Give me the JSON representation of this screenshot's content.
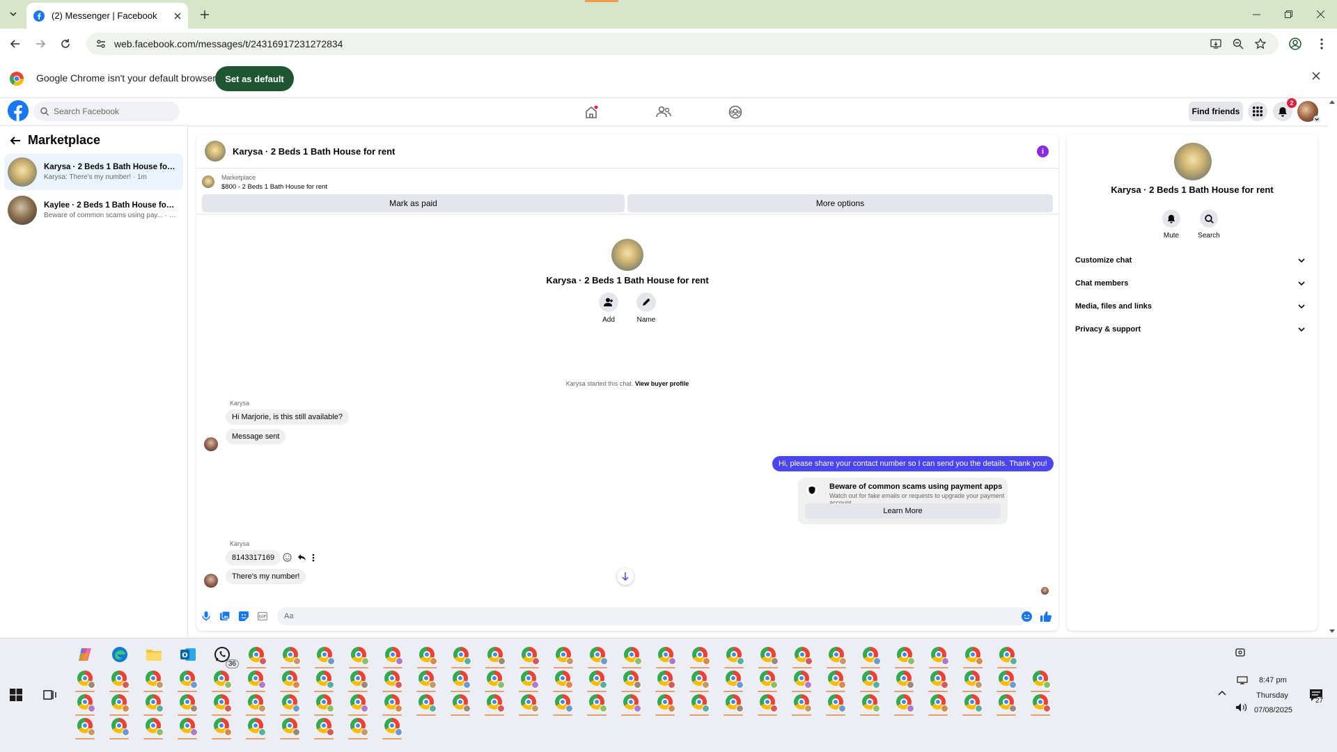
{
  "browser": {
    "tab_title": "(2) Messenger | Facebook",
    "url": "web.facebook.com/messages/t/24316917231272834",
    "infobar_text": "Google Chrome isn't your default browser",
    "infobar_button": "Set as default"
  },
  "fb_header": {
    "search_placeholder": "Search Facebook",
    "find_friends": "Find friends",
    "notification_count": "2"
  },
  "sidebar": {
    "heading": "Marketplace",
    "conversations": [
      {
        "name": "Karysa · 2 Beds 1 Bath House for r...",
        "snippet": "Karysa: There's my number! · 1m"
      },
      {
        "name": "Kaylee · 2 Beds 1 Bath House for re...",
        "snippet": "Beware of common scams using pay... · 3m"
      }
    ]
  },
  "chat": {
    "title": "Karysa · 2 Beds 1 Bath House for rent",
    "marketplace_label": "Marketplace",
    "listing": "$800 - 2 Beds 1 Bath House for rent",
    "mark_paid": "Mark as paid",
    "more_options": "More options",
    "intro_name": "Karysa · 2 Beds 1 Bath House for rent",
    "add_label": "Add",
    "name_label": "Name",
    "started_text": "Karysa started this chat.",
    "view_profile": "View buyer profile",
    "sender1": "Karysa",
    "msg1": "Hi Marjorie, is this still available?",
    "msg2": "Message sent",
    "out_msg": "Hi, please share your contact number so I can send you the details. Thank you!",
    "scam_title": "Beware of common scams using payment apps",
    "scam_sub": "Watch out for fake emails or requests to upgrade your payment account.",
    "learn_more": "Learn More",
    "sender2": "Karysa",
    "msg3": "8143317169",
    "msg4": "There's my number!",
    "composer_placeholder": "Aa"
  },
  "details": {
    "name": "Karysa · 2 Beds 1 Bath House for rent",
    "mute": "Mute",
    "search": "Search",
    "sections": [
      "Customize chat",
      "Chat members",
      "Media, files and links",
      "Privacy & support"
    ]
  },
  "taskbar": {
    "whatsapp_badge": "36",
    "time": "8:47 pm",
    "day": "Thursday",
    "date": "07/08/2025",
    "notif_count": "27"
  },
  "colors": {
    "facebook_blue": "#1877f2",
    "outgoing_bubble": "#4b44f2",
    "chrome_frame": "#d6e6c9",
    "set_default_button": "#1e5631"
  }
}
